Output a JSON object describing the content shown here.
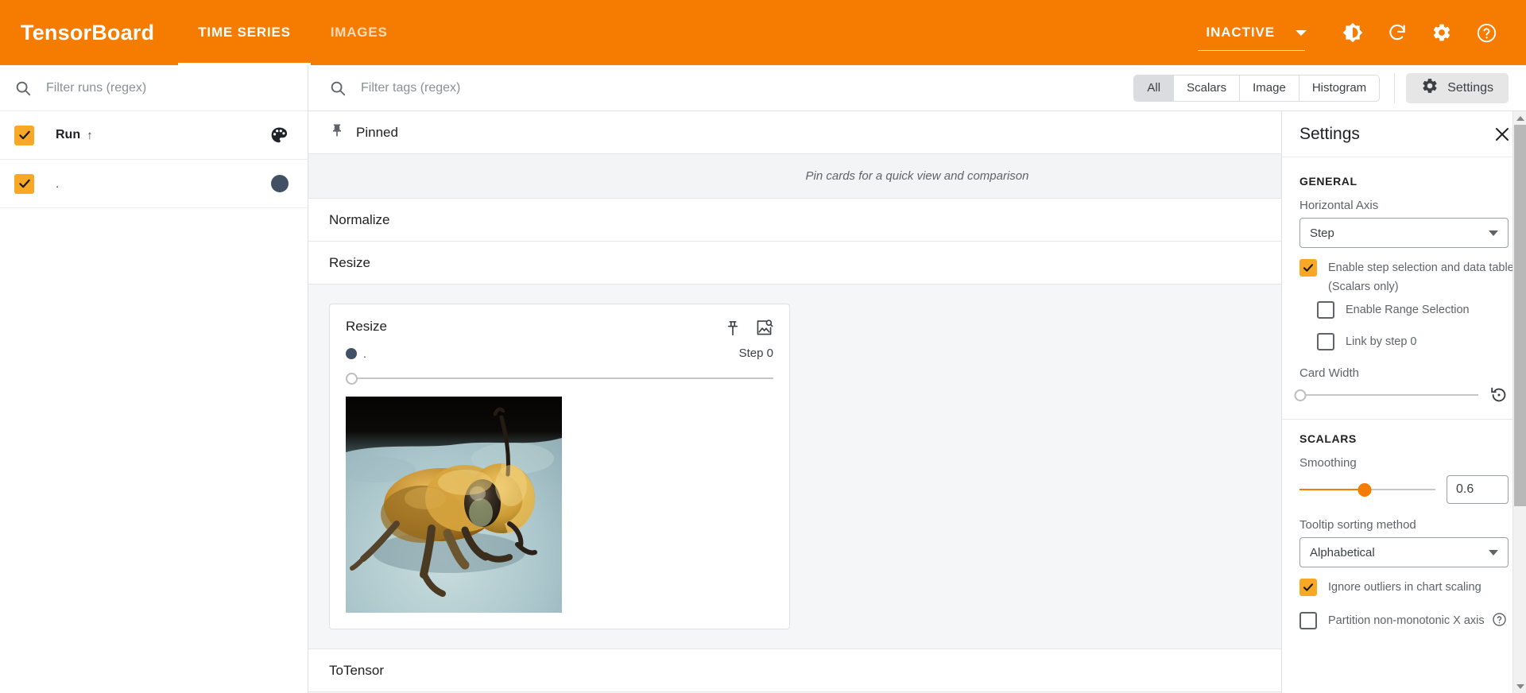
{
  "topbar": {
    "brand": "TensorBoard",
    "tabs": [
      {
        "label": "TIME SERIES",
        "active": true
      },
      {
        "label": "IMAGES",
        "active": false
      }
    ],
    "status": "INACTIVE",
    "icons": [
      "caret-down-icon",
      "brightness-icon",
      "refresh-icon",
      "settings-gear-icon",
      "help-icon"
    ],
    "accent_color": "#f57c00"
  },
  "sidebar": {
    "run_filter_placeholder": "Filter runs (regex)",
    "run_filter_value": "",
    "header": {
      "label": "Run",
      "sort_arrow": "↑",
      "checked": true
    },
    "runs": [
      {
        "label": ".",
        "checked": true,
        "color": "#425066"
      }
    ]
  },
  "tagbar": {
    "tag_filter_placeholder": "Filter tags (regex)",
    "tag_filter_value": "",
    "filters": [
      {
        "label": "All",
        "selected": true
      },
      {
        "label": "Scalars",
        "selected": false
      },
      {
        "label": "Image",
        "selected": false
      },
      {
        "label": "Histogram",
        "selected": false
      }
    ],
    "settings_button": "Settings"
  },
  "content": {
    "pinned": {
      "title": "Pinned",
      "empty_message": "Pin cards for a quick view and comparison"
    },
    "groups": [
      {
        "title": "Normalize",
        "expanded": false
      },
      {
        "title": "Resize",
        "expanded": true
      },
      {
        "title": "ToTensor",
        "expanded": false
      }
    ],
    "card": {
      "title": "Resize",
      "run_name": ".",
      "run_color": "#425066",
      "step_label": "Step 0",
      "slider_value": 0,
      "image_alt": "bee-photo"
    }
  },
  "settings": {
    "title": "Settings",
    "general": {
      "section": "GENERAL",
      "horizontal_axis_label": "Horizontal Axis",
      "horizontal_axis_value": "Step",
      "enable_step_selection": {
        "label": "Enable step selection and data table",
        "checked": true
      },
      "scalars_only_note": "(Scalars only)",
      "enable_range_selection": {
        "label": "Enable Range Selection",
        "checked": false
      },
      "link_by_step": {
        "label": "Link by step 0",
        "checked": false
      },
      "card_width_label": "Card Width",
      "card_width_value": 0
    },
    "scalars": {
      "section": "SCALARS",
      "smoothing_label": "Smoothing",
      "smoothing_value": "0.6",
      "tooltip_sorting_label": "Tooltip sorting method",
      "tooltip_sorting_value": "Alphabetical",
      "ignore_outliers": {
        "label": "Ignore outliers in chart scaling",
        "checked": true
      },
      "partition_non_monotonic": {
        "label": "Partition non-monotonic X axis",
        "checked": false
      }
    }
  }
}
